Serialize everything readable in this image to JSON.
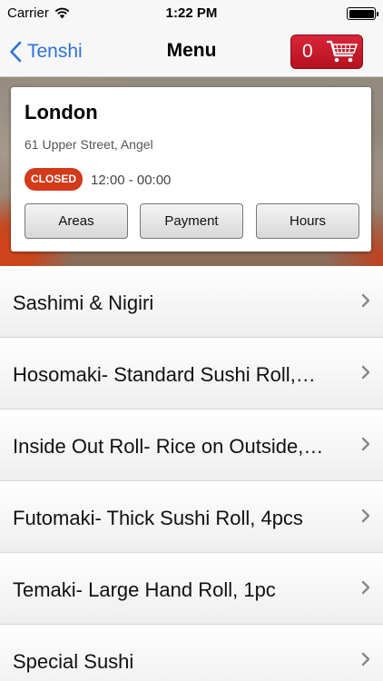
{
  "status_bar": {
    "carrier": "Carrier",
    "time": "1:22 PM"
  },
  "nav": {
    "back_label": "Tenshi",
    "title": "Menu",
    "cart_count": "0"
  },
  "restaurant": {
    "name": "London",
    "address": "61 Upper Street, Angel",
    "status": "CLOSED",
    "hours": "12:00 - 00:00",
    "buttons": {
      "areas": "Areas",
      "payment": "Payment",
      "hours": "Hours"
    }
  },
  "menu": {
    "items": [
      {
        "label": "Sashimi & Nigiri"
      },
      {
        "label": "Hosomaki- Standard Sushi Roll,…"
      },
      {
        "label": "Inside Out Roll- Rice on Outside,…"
      },
      {
        "label": "Futomaki- Thick Sushi Roll, 4pcs"
      },
      {
        "label": "Temaki- Large Hand Roll, 1pc"
      },
      {
        "label": "Special Sushi"
      }
    ]
  },
  "colors": {
    "accent": "#2a73d9",
    "cart": "#c4192b",
    "closed_badge": "#d23a1a"
  }
}
